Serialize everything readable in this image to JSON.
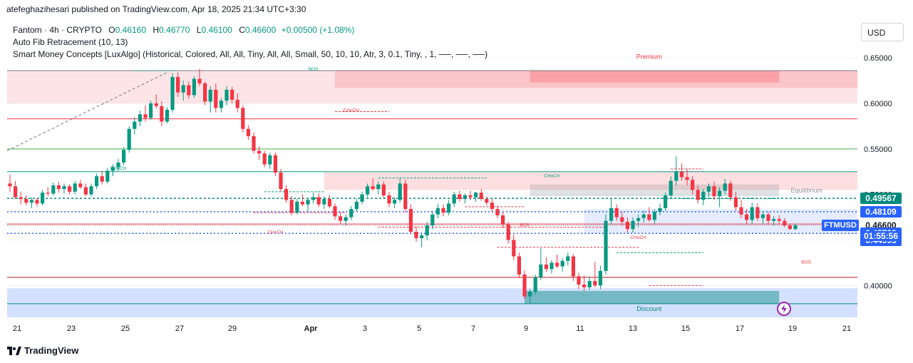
{
  "header": {
    "publisher_line": "atefeghazihesari published on TradingView.com, Apr 18, 2025 21:34 UTC+3:30"
  },
  "legend": {
    "symbol_line": "Fantom · 4h · CRYPTO",
    "open_label": "O",
    "open": "0.46160",
    "high_label": "H",
    "high": "0.46770",
    "low_label": "L",
    "low": "0.46100",
    "close_label": "C",
    "close": "0.46600",
    "change": "+0.00500 (+1.08%)",
    "indicator1": "Auto Fib Retracement (10, 13)",
    "indicator2": "Smart Money Concepts [LuxAlgo] (Historical, Colored, All, All, Tiny, All, All, Small, 50, 10, 10, Atr, 3, 0.1, Tiny, , 1, ──, ──, ──)"
  },
  "currency_button": "USD",
  "footer": {
    "brand": "TradingView"
  },
  "price_tags": {
    "symbol": "FTMUSD",
    "countdown": "01:55:56",
    "tags": [
      {
        "value": "0.49567",
        "color": "#00897b"
      },
      {
        "value": "0.48109",
        "color": "#2962ff"
      },
      {
        "value": "0.46600",
        "color": "#ffffff",
        "text": "#131722"
      },
      {
        "value": "0.45723",
        "color": "#2962ff"
      },
      {
        "value": "0.44995",
        "color": "#2962ff"
      }
    ]
  },
  "chart_data": {
    "type": "candlestick",
    "timeframe": "4h",
    "ylim": [
      0.365,
      0.665
    ],
    "y_ticks": [
      "0.65000",
      "0.60000",
      "0.55000",
      "0.50000",
      "0.45000",
      "0.40000"
    ],
    "x_ticks": [
      "21",
      "23",
      "25",
      "27",
      "29",
      "Apr",
      "3",
      "5",
      "7",
      "9",
      "11",
      "13",
      "15",
      "17",
      "19",
      "21"
    ],
    "zone_labels": {
      "premium": "Premium",
      "equilibrium": "Equilibrium",
      "discount": "Discount"
    },
    "structure_labels": [
      {
        "text": "BOS",
        "color": "#089981",
        "x_index": 56,
        "y": 0.636
      },
      {
        "text": "CHoCH",
        "color": "#f23645",
        "x_index": 63,
        "y": 0.591
      },
      {
        "text": "CHoCH",
        "color": "#089981",
        "x_index": 20,
        "y": 0.527
      },
      {
        "text": "CHoCH",
        "color": "#f23645",
        "x_index": 49,
        "y": 0.457
      },
      {
        "text": "CHoCH",
        "color": "#089981",
        "x_index": 100,
        "y": 0.519
      },
      {
        "text": "BOS",
        "color": "#f23645",
        "x_index": 95,
        "y": 0.465
      },
      {
        "text": "CHoCH",
        "color": "#f23645",
        "x_index": 116,
        "y": 0.451
      },
      {
        "text": "BOS",
        "color": "#f23645",
        "x_index": 147,
        "y": 0.424
      },
      {
        "text": "BOS",
        "color": "#f23645",
        "x_index": 175,
        "y": 0.404
      },
      {
        "text": "CHoCH",
        "color": "#089981",
        "x_index": 181,
        "y": 0.452
      },
      {
        "text": "BOS",
        "color": "#089981",
        "x_index": 201,
        "y": 0.508
      },
      {
        "text": "EQH",
        "color": "#f23645",
        "x_index": 237,
        "y": 0.526
      },
      {
        "text": "EQL",
        "color": "#089981",
        "x_index": 232,
        "y": 0.468
      },
      {
        "text": "EQL",
        "color": "#089981",
        "x_index": 174,
        "y": 0.373
      }
    ],
    "candles": [
      [
        0.512,
        0.522,
        0.503,
        0.509
      ],
      [
        0.509,
        0.515,
        0.495,
        0.497
      ],
      [
        0.497,
        0.503,
        0.489,
        0.495
      ],
      [
        0.495,
        0.499,
        0.488,
        0.491
      ],
      [
        0.491,
        0.497,
        0.485,
        0.494
      ],
      [
        0.494,
        0.496,
        0.487,
        0.49
      ],
      [
        0.49,
        0.505,
        0.488,
        0.502
      ],
      [
        0.502,
        0.508,
        0.498,
        0.501
      ],
      [
        0.501,
        0.513,
        0.499,
        0.51
      ],
      [
        0.51,
        0.514,
        0.502,
        0.506
      ],
      [
        0.506,
        0.512,
        0.501,
        0.509
      ],
      [
        0.509,
        0.511,
        0.5,
        0.503
      ],
      [
        0.503,
        0.515,
        0.5,
        0.512
      ],
      [
        0.512,
        0.516,
        0.506,
        0.508
      ],
      [
        0.508,
        0.512,
        0.498,
        0.5
      ],
      [
        0.5,
        0.512,
        0.498,
        0.509
      ],
      [
        0.509,
        0.523,
        0.506,
        0.52
      ],
      [
        0.52,
        0.526,
        0.511,
        0.514
      ],
      [
        0.514,
        0.529,
        0.512,
        0.526
      ],
      [
        0.526,
        0.533,
        0.52,
        0.53
      ],
      [
        0.53,
        0.539,
        0.526,
        0.535
      ],
      [
        0.535,
        0.552,
        0.532,
        0.549
      ],
      [
        0.549,
        0.575,
        0.546,
        0.572
      ],
      [
        0.572,
        0.585,
        0.566,
        0.58
      ],
      [
        0.58,
        0.592,
        0.575,
        0.588
      ],
      [
        0.588,
        0.598,
        0.58,
        0.584
      ],
      [
        0.584,
        0.603,
        0.582,
        0.6
      ],
      [
        0.6,
        0.61,
        0.594,
        0.597
      ],
      [
        0.597,
        0.602,
        0.575,
        0.58
      ],
      [
        0.58,
        0.596,
        0.578,
        0.593
      ],
      [
        0.593,
        0.633,
        0.59,
        0.629
      ],
      [
        0.629,
        0.634,
        0.607,
        0.612
      ],
      [
        0.612,
        0.625,
        0.603,
        0.62
      ],
      [
        0.62,
        0.624,
        0.605,
        0.609
      ],
      [
        0.609,
        0.63,
        0.606,
        0.627
      ],
      [
        0.627,
        0.638,
        0.619,
        0.622
      ],
      [
        0.622,
        0.624,
        0.598,
        0.602
      ],
      [
        0.602,
        0.619,
        0.59,
        0.615
      ],
      [
        0.615,
        0.622,
        0.59,
        0.595
      ],
      [
        0.595,
        0.606,
        0.59,
        0.603
      ],
      [
        0.603,
        0.619,
        0.598,
        0.615
      ],
      [
        0.615,
        0.618,
        0.6,
        0.604
      ],
      [
        0.604,
        0.611,
        0.59,
        0.595
      ],
      [
        0.595,
        0.598,
        0.568,
        0.572
      ],
      [
        0.572,
        0.576,
        0.56,
        0.564
      ],
      [
        0.564,
        0.568,
        0.545,
        0.548
      ],
      [
        0.548,
        0.553,
        0.538,
        0.545
      ],
      [
        0.545,
        0.548,
        0.53,
        0.533
      ],
      [
        0.533,
        0.546,
        0.528,
        0.543
      ],
      [
        0.543,
        0.546,
        0.52,
        0.524
      ],
      [
        0.524,
        0.528,
        0.503,
        0.506
      ],
      [
        0.506,
        0.51,
        0.491,
        0.494
      ],
      [
        0.494,
        0.498,
        0.477,
        0.48
      ],
      [
        0.48,
        0.495,
        0.478,
        0.492
      ],
      [
        0.492,
        0.5,
        0.487,
        0.489
      ],
      [
        0.489,
        0.496,
        0.481,
        0.494
      ],
      [
        0.494,
        0.502,
        0.49,
        0.497
      ],
      [
        0.497,
        0.501,
        0.486,
        0.489
      ],
      [
        0.489,
        0.498,
        0.484,
        0.495
      ],
      [
        0.495,
        0.499,
        0.485,
        0.487
      ],
      [
        0.487,
        0.49,
        0.472,
        0.476
      ],
      [
        0.476,
        0.48,
        0.468,
        0.471
      ],
      [
        0.471,
        0.478,
        0.466,
        0.475
      ],
      [
        0.475,
        0.487,
        0.472,
        0.484
      ],
      [
        0.484,
        0.495,
        0.481,
        0.492
      ],
      [
        0.492,
        0.503,
        0.489,
        0.5
      ],
      [
        0.5,
        0.512,
        0.497,
        0.509
      ],
      [
        0.509,
        0.518,
        0.504,
        0.506
      ],
      [
        0.506,
        0.514,
        0.5,
        0.511
      ],
      [
        0.511,
        0.514,
        0.496,
        0.499
      ],
      [
        0.499,
        0.503,
        0.486,
        0.49
      ],
      [
        0.49,
        0.497,
        0.485,
        0.494
      ],
      [
        0.494,
        0.518,
        0.491,
        0.512
      ],
      [
        0.512,
        0.516,
        0.48,
        0.484
      ],
      [
        0.484,
        0.489,
        0.456,
        0.459
      ],
      [
        0.459,
        0.465,
        0.448,
        0.452
      ],
      [
        0.452,
        0.458,
        0.442,
        0.455
      ],
      [
        0.455,
        0.47,
        0.45,
        0.466
      ],
      [
        0.466,
        0.482,
        0.462,
        0.478
      ],
      [
        0.478,
        0.49,
        0.474,
        0.485
      ],
      [
        0.485,
        0.489,
        0.476,
        0.48
      ],
      [
        0.48,
        0.494,
        0.477,
        0.49
      ],
      [
        0.49,
        0.503,
        0.486,
        0.5
      ],
      [
        0.5,
        0.504,
        0.492,
        0.495
      ],
      [
        0.495,
        0.501,
        0.49,
        0.499
      ],
      [
        0.499,
        0.504,
        0.494,
        0.497
      ],
      [
        0.497,
        0.503,
        0.492,
        0.502
      ],
      [
        0.502,
        0.506,
        0.493,
        0.495
      ],
      [
        0.495,
        0.498,
        0.488,
        0.491
      ],
      [
        0.491,
        0.495,
        0.48,
        0.484
      ],
      [
        0.484,
        0.488,
        0.474,
        0.477
      ],
      [
        0.477,
        0.481,
        0.463,
        0.467
      ],
      [
        0.467,
        0.47,
        0.446,
        0.45
      ],
      [
        0.45,
        0.456,
        0.428,
        0.432
      ],
      [
        0.432,
        0.436,
        0.408,
        0.412
      ],
      [
        0.412,
        0.417,
        0.385,
        0.388
      ],
      [
        0.388,
        0.396,
        0.38,
        0.393
      ],
      [
        0.393,
        0.412,
        0.39,
        0.409
      ],
      [
        0.409,
        0.441,
        0.406,
        0.423
      ],
      [
        0.423,
        0.431,
        0.415,
        0.418
      ],
      [
        0.418,
        0.428,
        0.413,
        0.425
      ],
      [
        0.425,
        0.434,
        0.419,
        0.421
      ],
      [
        0.421,
        0.43,
        0.415,
        0.427
      ],
      [
        0.427,
        0.436,
        0.422,
        0.432
      ],
      [
        0.432,
        0.434,
        0.405,
        0.41
      ],
      [
        0.41,
        0.414,
        0.396,
        0.401
      ],
      [
        0.401,
        0.411,
        0.394,
        0.398
      ],
      [
        0.398,
        0.41,
        0.395,
        0.405
      ],
      [
        0.405,
        0.426,
        0.398,
        0.4
      ],
      [
        0.4,
        0.422,
        0.396,
        0.416
      ],
      [
        0.416,
        0.478,
        0.412,
        0.471
      ],
      [
        0.471,
        0.495,
        0.467,
        0.485
      ],
      [
        0.485,
        0.489,
        0.471,
        0.475
      ],
      [
        0.475,
        0.481,
        0.466,
        0.47
      ],
      [
        0.47,
        0.475,
        0.458,
        0.462
      ],
      [
        0.462,
        0.475,
        0.458,
        0.471
      ],
      [
        0.471,
        0.478,
        0.464,
        0.474
      ],
      [
        0.474,
        0.482,
        0.469,
        0.478
      ],
      [
        0.478,
        0.486,
        0.47,
        0.472
      ],
      [
        0.472,
        0.484,
        0.468,
        0.481
      ],
      [
        0.481,
        0.49,
        0.477,
        0.485
      ],
      [
        0.485,
        0.502,
        0.482,
        0.499
      ],
      [
        0.499,
        0.52,
        0.496,
        0.515
      ],
      [
        0.515,
        0.542,
        0.51,
        0.525
      ],
      [
        0.525,
        0.534,
        0.515,
        0.519
      ],
      [
        0.519,
        0.528,
        0.51,
        0.516
      ],
      [
        0.516,
        0.52,
        0.5,
        0.505
      ],
      [
        0.505,
        0.51,
        0.49,
        0.494
      ],
      [
        0.494,
        0.506,
        0.488,
        0.503
      ],
      [
        0.503,
        0.512,
        0.497,
        0.509
      ],
      [
        0.509,
        0.514,
        0.494,
        0.498
      ],
      [
        0.498,
        0.508,
        0.486,
        0.504
      ],
      [
        0.504,
        0.517,
        0.5,
        0.512
      ],
      [
        0.512,
        0.515,
        0.493,
        0.497
      ],
      [
        0.497,
        0.503,
        0.482,
        0.486
      ],
      [
        0.486,
        0.494,
        0.474,
        0.478
      ],
      [
        0.478,
        0.484,
        0.467,
        0.472
      ],
      [
        0.472,
        0.491,
        0.468,
        0.486
      ],
      [
        0.486,
        0.49,
        0.471,
        0.474
      ],
      [
        0.474,
        0.482,
        0.468,
        0.478
      ],
      [
        0.478,
        0.481,
        0.467,
        0.471
      ],
      [
        0.471,
        0.476,
        0.466,
        0.473
      ],
      [
        0.473,
        0.477,
        0.468,
        0.471
      ],
      [
        0.471,
        0.474,
        0.464,
        0.466
      ],
      [
        0.466,
        0.468,
        0.461,
        0.462
      ],
      [
        0.462,
        0.4677,
        0.461,
        0.466
      ]
    ]
  }
}
